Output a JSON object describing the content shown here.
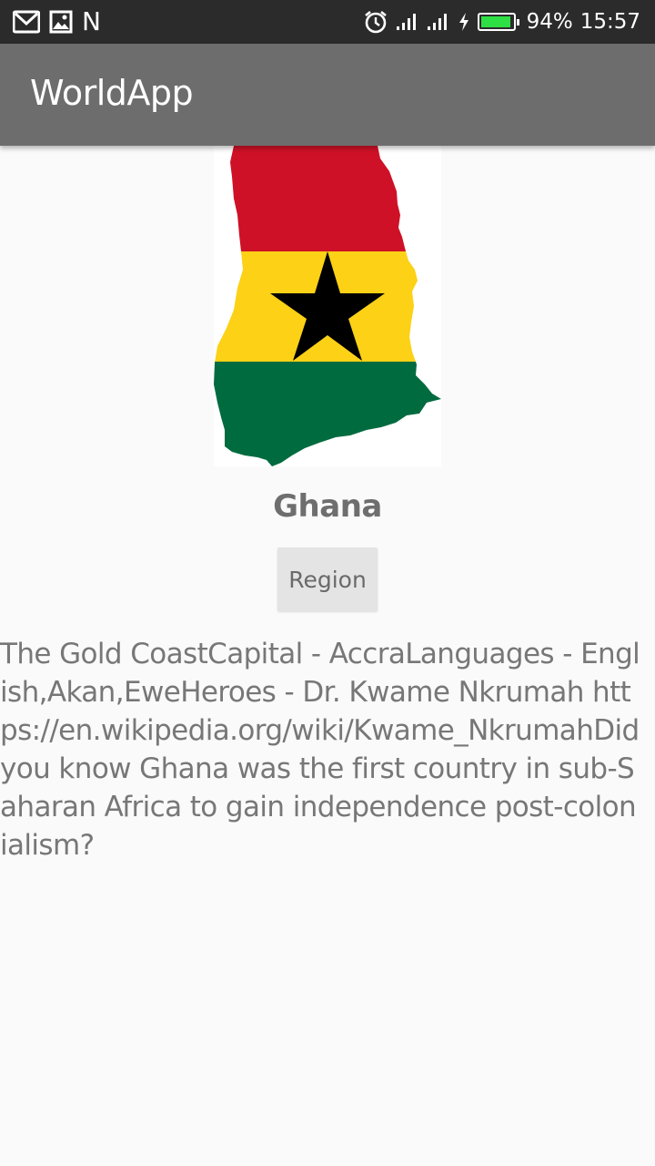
{
  "status_bar": {
    "left_icons": [
      "gmail-icon",
      "gallery-icon",
      "n-icon"
    ],
    "n_label": "N",
    "right_icons": [
      "alarm-icon",
      "signal-icon",
      "signal-icon",
      "charging-icon",
      "battery-icon"
    ],
    "battery_percent": "94%",
    "battery_level": 0.94,
    "battery_color": "#2ee044",
    "time": "15:57"
  },
  "app_bar": {
    "title": "WorldApp",
    "color": "#6d6d6d"
  },
  "country": {
    "name": "Ghana",
    "flag_colors": {
      "red": "#ce1126",
      "yellow": "#fcd116",
      "green": "#006b3f",
      "star": "#000000"
    }
  },
  "region_button": {
    "label": "Region"
  },
  "description": {
    "text": "The Gold CoastCapital - AccraLanguages - English,Akan,EweHeroes - Dr. Kwame Nkrumah https://en.wikipedia.org/wiki/Kwame_NkrumahDid you know Ghana was the first country in sub-Saharan Africa to gain independence post-colonialism?"
  }
}
